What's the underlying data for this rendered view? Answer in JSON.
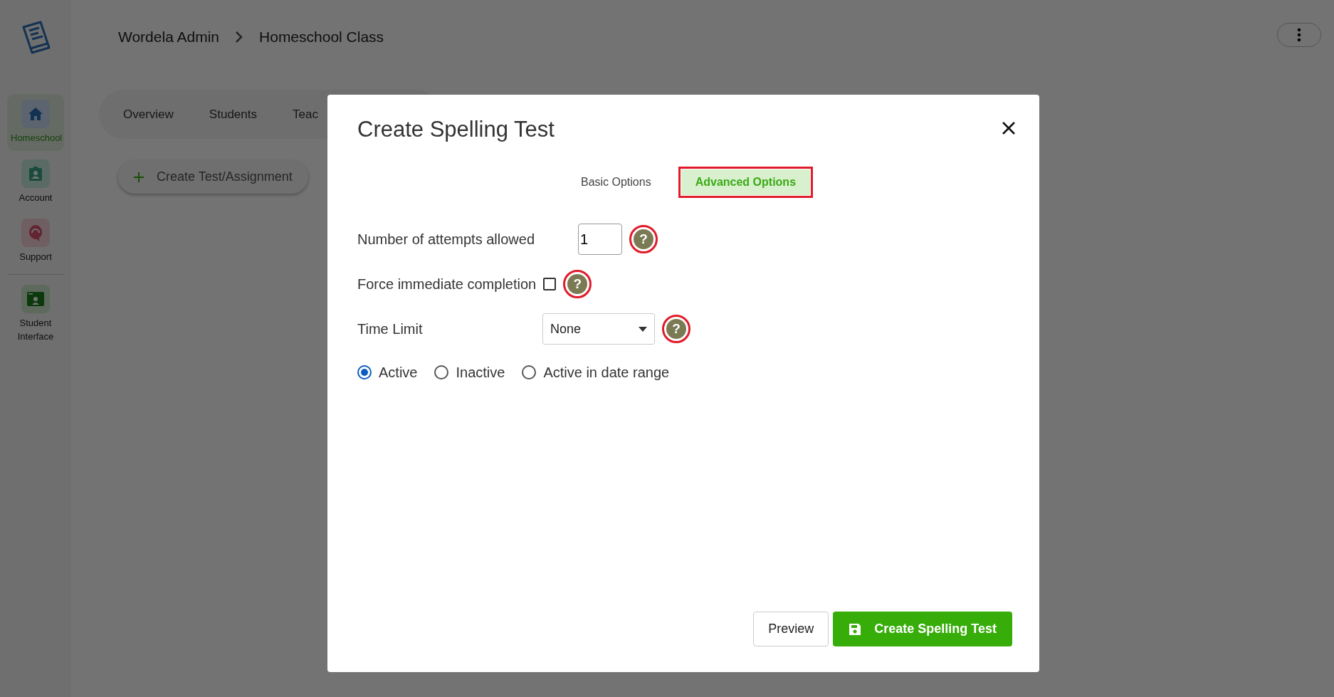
{
  "sidebar": {
    "items": [
      {
        "label": "Homeschool",
        "selected": true
      },
      {
        "label": "Account",
        "selected": false
      },
      {
        "label": "Support",
        "selected": false
      },
      {
        "label": "Student Interface",
        "selected": false
      }
    ]
  },
  "breadcrumb": [
    "Wordela Admin",
    "Homeschool Class"
  ],
  "nav_tabs": [
    {
      "label": "Overview"
    },
    {
      "label": "Students"
    },
    {
      "label": "Teac"
    }
  ],
  "create_button": "Create Test/Assignment",
  "dialog": {
    "title": "Create Spelling Test",
    "tabs": [
      {
        "label": "Basic Options",
        "selected": false
      },
      {
        "label": "Advanced Options",
        "selected": true
      }
    ],
    "fields": [
      {
        "kind": "number",
        "label": "Number of attempts allowed",
        "value": "1",
        "help": "?"
      },
      {
        "kind": "checkbox",
        "label": "Force immediate completion",
        "checked": false,
        "help": "?"
      },
      {
        "kind": "select",
        "label": "Time Limit",
        "value": "None",
        "help": "?"
      }
    ],
    "status_options": [
      {
        "label": "Active",
        "selected": true
      },
      {
        "label": "Inactive",
        "selected": false
      },
      {
        "label": "Active in date range",
        "selected": false
      }
    ],
    "buttons": [
      {
        "kind": "secondary",
        "label": "Preview"
      },
      {
        "kind": "primary",
        "label": "Create Spelling Test"
      }
    ]
  }
}
